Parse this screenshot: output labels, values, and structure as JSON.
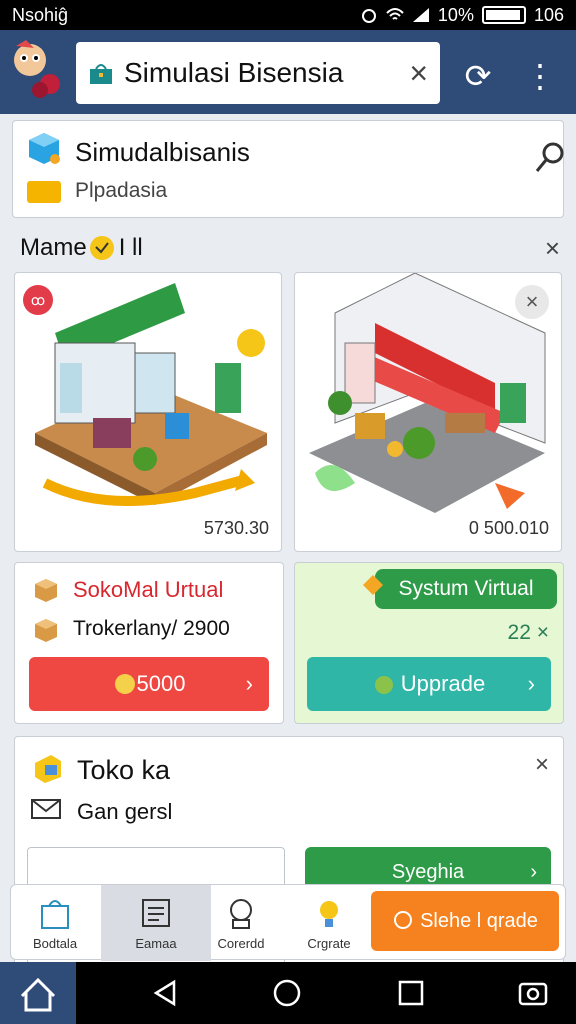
{
  "status_bar": {
    "carrier": "Nsohiĝ",
    "battery": "10%",
    "time": "106"
  },
  "search": {
    "value": "Simulasi Bisensia"
  },
  "header_card": {
    "title": "Simudalbisanis",
    "subtitle": "Plpadasia"
  },
  "section": {
    "label": "Mame",
    "suffix": "I ll"
  },
  "images": [
    {
      "price": "5730.30",
      "pin": "ꝏ"
    },
    {
      "price": "0 500.010"
    }
  ],
  "store_card": {
    "title": "SokoMal Urtual",
    "detail": "Trokerlany/ 2900",
    "button_label": "5000"
  },
  "system_card": {
    "pill_label": "Systum Virtual",
    "count": "22 ×",
    "button_label": "Upprade"
  },
  "toko_card": {
    "title": "Toko ka",
    "subtitle": "Gan gersl",
    "button_label": "Syeghia"
  },
  "bottom_nav": {
    "items": [
      {
        "label": "Bodtala"
      },
      {
        "label": "Eamaa"
      },
      {
        "label": "Corerdd"
      },
      {
        "label": "Crgrate"
      }
    ],
    "upgrade_label": "Slehe l qrade"
  },
  "colors": {
    "topbar": "#2f4b78",
    "red": "#ef4742",
    "teal": "#2fb6a6",
    "green": "#2e9b48",
    "orange": "#f5821f"
  },
  "icons": {
    "close": "×",
    "chevron": "›",
    "refresh": "⟳",
    "more": "⋮"
  }
}
